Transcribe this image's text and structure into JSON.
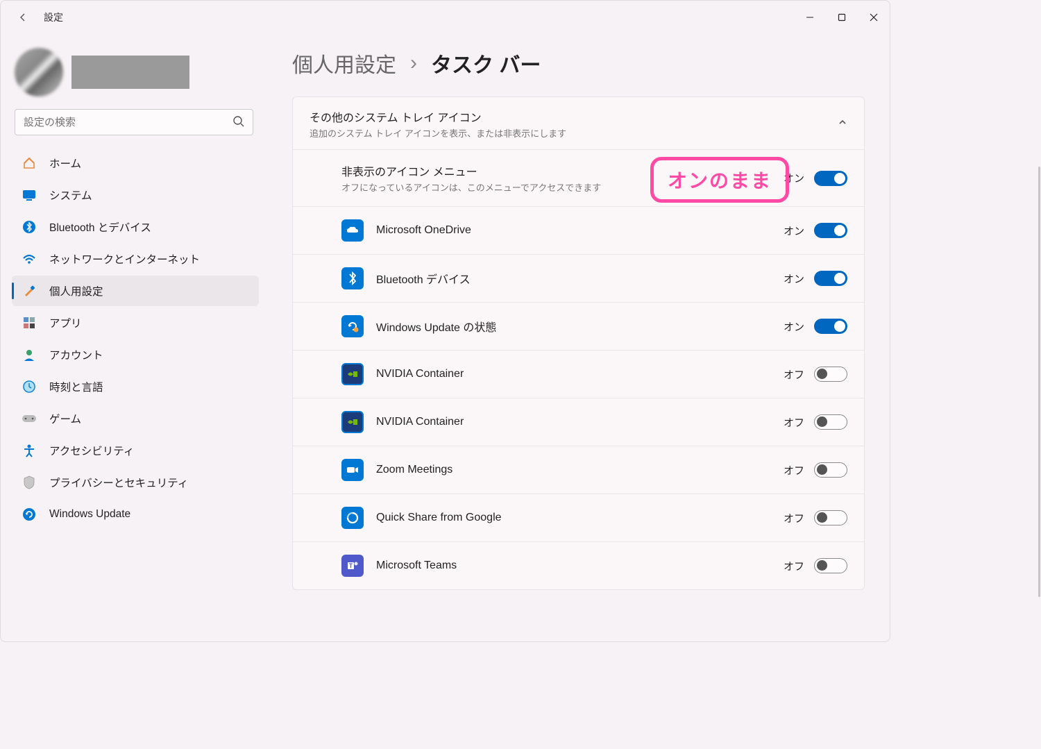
{
  "titlebar": {
    "app": "設定"
  },
  "search": {
    "placeholder": "設定の検索"
  },
  "nav": [
    {
      "label": "ホーム"
    },
    {
      "label": "システム"
    },
    {
      "label": "Bluetooth とデバイス"
    },
    {
      "label": "ネットワークとインターネット"
    },
    {
      "label": "個人用設定"
    },
    {
      "label": "アプリ"
    },
    {
      "label": "アカウント"
    },
    {
      "label": "時刻と言語"
    },
    {
      "label": "ゲーム"
    },
    {
      "label": "アクセシビリティ"
    },
    {
      "label": "プライバシーとセキュリティ"
    },
    {
      "label": "Windows Update"
    }
  ],
  "breadcrumb": {
    "parent": "個人用設定",
    "sep": "›",
    "current": "タスク バー"
  },
  "section": {
    "title": "その他のシステム トレイ アイコン",
    "subtitle": "追加のシステム トレイ アイコンを表示、または非表示にします"
  },
  "annotation": "オンのまま",
  "toggle_on": "オン",
  "toggle_off": "オフ",
  "rows": [
    {
      "label": "非表示のアイコン メニュー",
      "desc": "オフになっているアイコンは、このメニューでアクセスできます",
      "state": "on"
    },
    {
      "label": "Microsoft OneDrive",
      "state": "on"
    },
    {
      "label": "Bluetooth デバイス",
      "state": "on"
    },
    {
      "label": "Windows Update の状態",
      "state": "on"
    },
    {
      "label": "NVIDIA Container",
      "state": "off"
    },
    {
      "label": "NVIDIA Container",
      "state": "off"
    },
    {
      "label": "Zoom Meetings",
      "state": "off"
    },
    {
      "label": "Quick Share from Google",
      "state": "off"
    },
    {
      "label": "Microsoft Teams",
      "state": "off"
    }
  ]
}
